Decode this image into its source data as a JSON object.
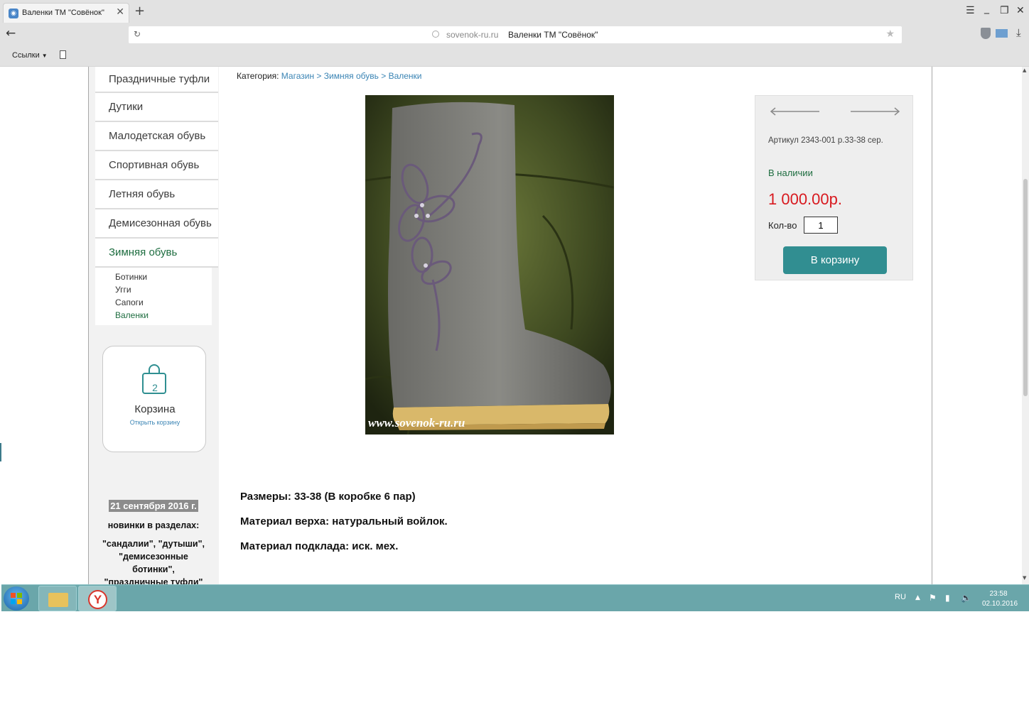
{
  "browser": {
    "tab_title": "Валенки ТМ \"Совёнок\"",
    "tab_close": "✕",
    "new_tab": "+",
    "url_domain": "sovenok-ru.ru",
    "page_title": "Валенки ТМ \"Совёнок\"",
    "bookmark_links": "Ссылки",
    "back_glyph": "←",
    "reload_glyph": "↻",
    "star_glyph": "★",
    "download_glyph": "⤓",
    "menu_glyph": "☰",
    "minimize_glyph": "_",
    "maximize_glyph": "❐",
    "close_glyph": "✕"
  },
  "sidebar": {
    "menu": [
      {
        "label": "Праздничные туфли"
      },
      {
        "label": "Дутики"
      },
      {
        "label": "Малодетская обувь"
      },
      {
        "label": "Спортивная обувь"
      },
      {
        "label": "Летняя обувь"
      },
      {
        "label": "Демисезонная обувь"
      },
      {
        "label": "Зимняя обувь"
      }
    ],
    "submenu": [
      {
        "label": "Ботинки"
      },
      {
        "label": "Угги"
      },
      {
        "label": "Сапоги"
      },
      {
        "label": "Валенки"
      }
    ],
    "cart": {
      "count": "2",
      "title": "Корзина",
      "link": "Открыть корзину"
    },
    "news": {
      "date": "21 сентября 2016 г.",
      "line1": "новинки в разделах:",
      "line2": "\"сандалии\", \"дутыши\",",
      "line3": "\"демисезонные",
      "line4": "ботинки\",",
      "line5": "\"праздничные туфли\""
    }
  },
  "breadcrumb": {
    "label": "Категория:",
    "items": [
      "Магазин",
      "Зимняя обувь",
      "Валенки"
    ],
    "separator": ">"
  },
  "product": {
    "watermark": "www.sovenok-ru.ru",
    "sku": "Артикул 2343-001 р.33-38 сер.",
    "stock": "В наличии",
    "price": "1 000.00р.",
    "qty_label": "Кол-во",
    "qty_value": "1",
    "add_to_cart": "В корзину",
    "specs": [
      "Размеры: 33-38 (В коробке 6 пар)",
      "Материал верха: натуральный войлок.",
      "Материал подклада: иск. мех."
    ]
  },
  "taskbar": {
    "lang": "RU",
    "time": "23:58",
    "date": "02.10.2016",
    "yandex_letter": "Y"
  },
  "colors": {
    "accent": "#318e91",
    "price": "#d8191f",
    "link": "#3a84b4",
    "active": "#1e6d40"
  }
}
